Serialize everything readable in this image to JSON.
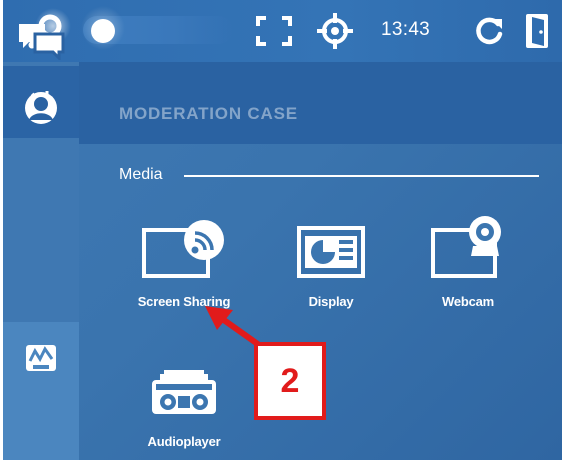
{
  "topbar": {
    "clock": "13:43",
    "icons": [
      "search-icon",
      "fullscreen-icon",
      "crosshair-icon",
      "refresh-icon",
      "exit-door-icon"
    ],
    "slider_state": "off"
  },
  "sidebar": {
    "items": [
      {
        "name": "collapse",
        "icon": "collapse-panel-icon"
      },
      {
        "name": "chat",
        "icon": "chat-bubbles-icon"
      },
      {
        "name": "participants",
        "icon": "user-icon"
      },
      {
        "name": "media",
        "icon": "media-briefcase-icon",
        "active": true
      }
    ]
  },
  "main": {
    "title": "MODERATION CASE",
    "section": "Media",
    "items": [
      {
        "label": "Screen Sharing",
        "icon": "screen-sharing-icon"
      },
      {
        "label": "Display",
        "icon": "display-icon"
      },
      {
        "label": "Webcam",
        "icon": "webcam-icon"
      },
      {
        "label": "Audioplayer",
        "icon": "audioplayer-icon"
      }
    ]
  },
  "annotation": {
    "number": "2",
    "color": "#e11b1b"
  }
}
